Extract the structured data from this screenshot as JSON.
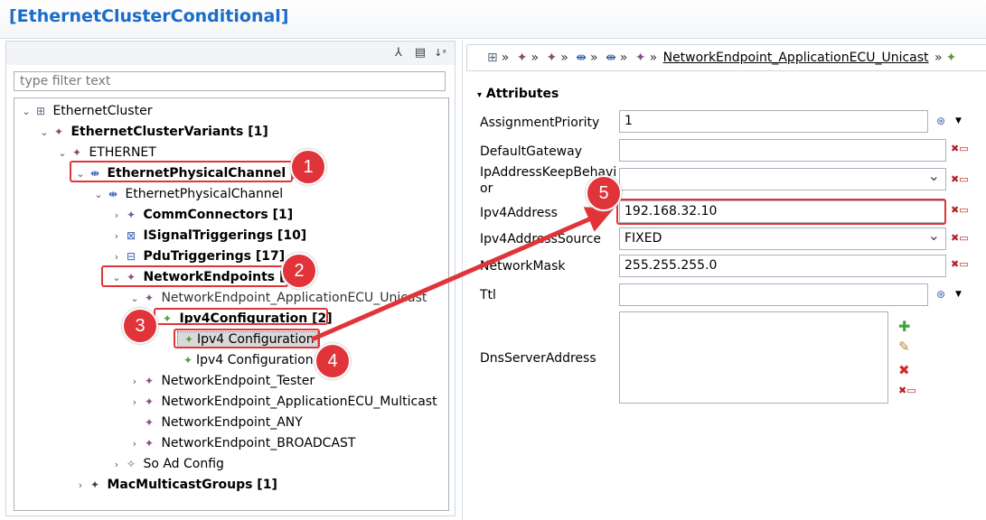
{
  "window": {
    "title": "[EthernetClusterConditional]"
  },
  "left_toolbar": {
    "icons": [
      "collapse-all-icon",
      "document-icon",
      "sort-icon"
    ]
  },
  "filter": {
    "placeholder": "type filter text"
  },
  "tree": [
    {
      "label": "EthernetCluster",
      "bold": false,
      "icon": "cluster-icon"
    },
    {
      "label": "EthernetClusterVariants [1]",
      "bold": true,
      "icon": "variant-icon"
    },
    {
      "label": "ETHERNET",
      "bold": false,
      "icon": "variant-icon"
    },
    {
      "label": "EthernetPhysicalChannel [1]",
      "bold": true,
      "icon": "channel-icon"
    },
    {
      "label": "EthernetPhysicalChannel",
      "bold": false,
      "icon": "channel-icon"
    },
    {
      "label": "CommConnectors [1]",
      "bold": true,
      "icon": "connector-icon"
    },
    {
      "label": "ISignalTriggerings [10]",
      "bold": true,
      "icon": "signal-icon"
    },
    {
      "label": "PduTriggerings [17]",
      "bold": true,
      "icon": "pdu-icon"
    },
    {
      "label": "NetworkEndpoints [5]",
      "bold": true,
      "icon": "endpoint-icon"
    },
    {
      "label": "NetworkEndpoint_ApplicationECU_Unicast",
      "bold": false,
      "icon": "endpoint-icon"
    },
    {
      "label": "Ipv4Configuration [2]",
      "bold": true,
      "icon": "ipv4-icon"
    },
    {
      "label": "Ipv4 Configuration",
      "bold": false,
      "icon": "ipv4-icon"
    },
    {
      "label": "Ipv4 Configuration",
      "bold": false,
      "icon": "ipv4-icon"
    },
    {
      "label": "NetworkEndpoint_Tester",
      "bold": false,
      "icon": "endpoint-icon"
    },
    {
      "label": "NetworkEndpoint_ApplicationECU_Multicast",
      "bold": false,
      "icon": "endpoint-icon"
    },
    {
      "label": "NetworkEndpoint_ANY",
      "bold": false,
      "icon": "endpoint-icon"
    },
    {
      "label": "NetworkEndpoint_BROADCAST",
      "bold": false,
      "icon": "endpoint-icon"
    },
    {
      "label": "So Ad Config",
      "bold": false,
      "icon": "config-icon"
    },
    {
      "label": "MacMulticastGroups [1]",
      "bold": true,
      "icon": "group-icon"
    }
  ],
  "breadcrumb": {
    "current": "NetworkEndpoint_ApplicationECU_Unicast"
  },
  "attributes": {
    "section_title": "Attributes",
    "assignment_priority": {
      "label": "AssignmentPriority",
      "value": "1"
    },
    "default_gateway": {
      "label": "DefaultGateway",
      "value": ""
    },
    "ip_keep": {
      "label_1": "IpAddressKeepBehavi",
      "label_2": "or",
      "value": ""
    },
    "ipv4_address": {
      "label": "Ipv4Address",
      "value": "192.168.32.10"
    },
    "ipv4_source": {
      "label": "Ipv4AddressSource",
      "value": "FIXED"
    },
    "network_mask": {
      "label": "NetworkMask",
      "value": "255.255.255.0"
    },
    "ttl": {
      "label": "Ttl",
      "value": ""
    },
    "dns": {
      "label": "DnsServerAddress"
    }
  },
  "callouts": [
    "1",
    "2",
    "3",
    "4",
    "5"
  ],
  "colors": {
    "title": "#1b6bc9",
    "annotation": "#e0343a",
    "endpoint_icon": "#8a4f8a",
    "ipv4_icon": "#5c9a3c"
  }
}
